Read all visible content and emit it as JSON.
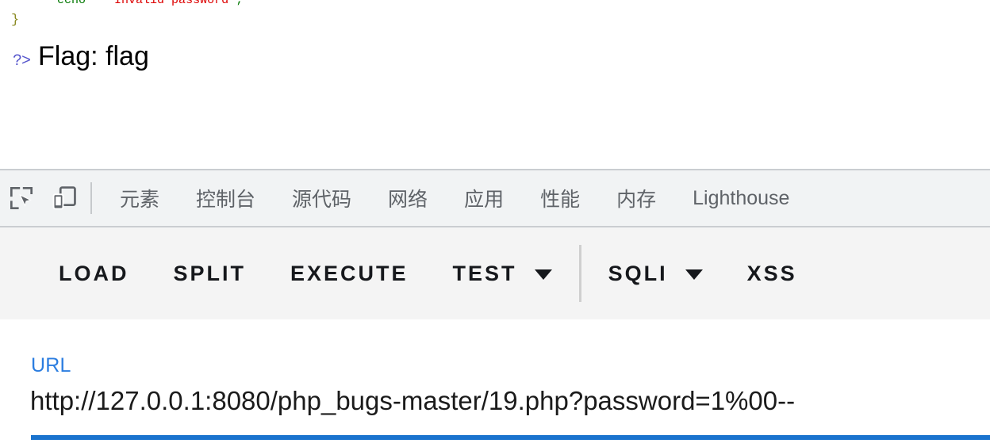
{
  "page_output": {
    "clipped_code_line": {
      "indent": "        ",
      "keyword": "echo",
      "spacer": "   ",
      "string": "\"Invalid password\"",
      "punctuation": ";"
    },
    "closing_brace": "}",
    "php_close_tag": "?>",
    "flag_text": "Flag: flag"
  },
  "devtools": {
    "icons": [
      {
        "name": "inspect-element-icon",
        "label": "Inspect element"
      },
      {
        "name": "device-toolbar-icon",
        "label": "Toggle device toolbar"
      }
    ],
    "tabs": [
      {
        "label": "元素"
      },
      {
        "label": "控制台"
      },
      {
        "label": "源代码"
      },
      {
        "label": "网络"
      },
      {
        "label": "应用"
      },
      {
        "label": "性能"
      },
      {
        "label": "内存"
      },
      {
        "label": "Lighthouse"
      }
    ]
  },
  "action_toolbar": {
    "buttons": [
      {
        "label": "LOAD",
        "has_caret": false
      },
      {
        "label": "SPLIT",
        "has_caret": false
      },
      {
        "label": "EXECUTE",
        "has_caret": false
      },
      {
        "label": "TEST",
        "has_caret": true
      },
      {
        "label": "SQLI",
        "has_caret": true
      },
      {
        "label": "XSS",
        "has_caret": false
      }
    ]
  },
  "url_field": {
    "label": "URL",
    "value": "http://127.0.0.1:8080/php_bugs-master/19.php?password=1%00--",
    "placeholder": "URL"
  },
  "colors": {
    "accent_blue": "#1a73ce",
    "label_blue": "#2b7de0",
    "tab_text": "#5f6368",
    "tabbar_bg": "#f1f3f4",
    "toolbar_bg": "#f4f4f4",
    "code_keyword_green": "#007700",
    "code_string_red": "#dd0000",
    "php_tag_blue": "#5555cc"
  }
}
